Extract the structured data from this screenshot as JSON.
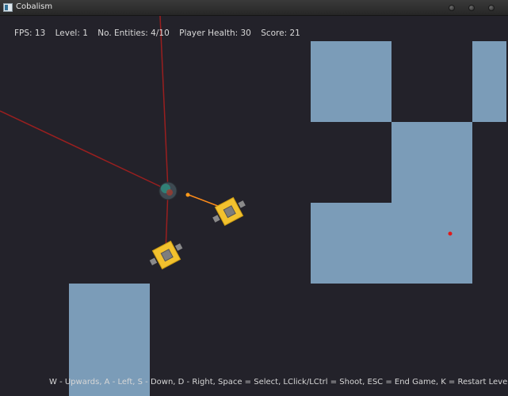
{
  "window": {
    "title": "Cobalism"
  },
  "hud": {
    "fps": "FPS: 13",
    "level": "Level: 1",
    "entities": "No. Entities: 4/10",
    "health": "Player Health: 30",
    "score": "Score: 21"
  },
  "controls_help": "W - Upwards, A - Left, S - Down, D - Right, Space = Select, LClick/LCtrl = Shoot, ESC = End Game, K = Restart Level",
  "colors": {
    "background": "#23222a",
    "wall": "#7b9cb8",
    "laser": "#9a1f1f",
    "tank_body": "#f2c12e",
    "projectile": "#ff9a1a"
  }
}
